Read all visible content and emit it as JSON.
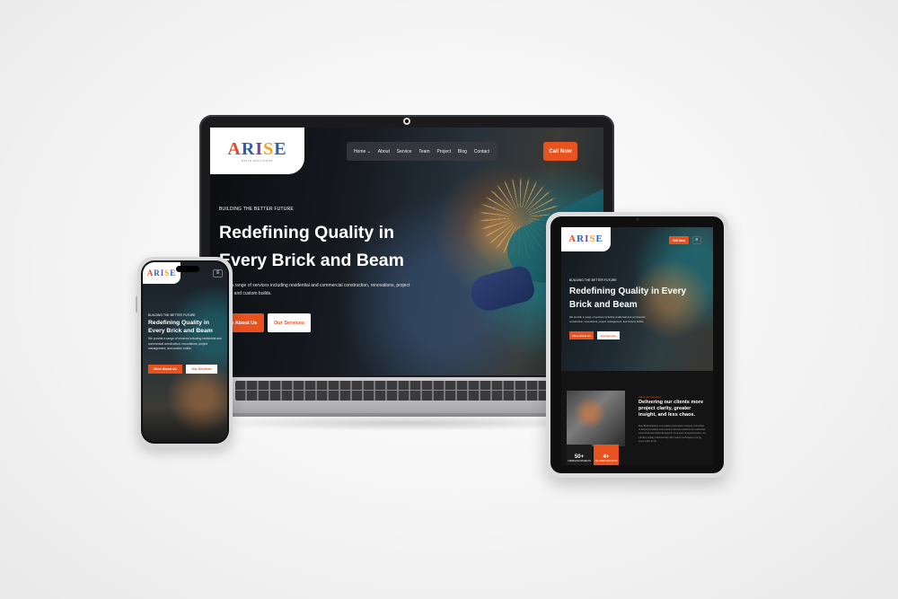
{
  "brand": {
    "logo_letters": [
      "A",
      "R",
      "I",
      "S",
      "E"
    ],
    "logo_tagline": "BUILD SOLUTIONS",
    "accent_color": "#e8521f"
  },
  "nav": {
    "items": [
      "Home",
      "About",
      "Service",
      "Team",
      "Project",
      "Blog",
      "Contact"
    ],
    "home_dropdown_icon": "chevron-down-icon",
    "cta": "Call Now",
    "menu_icon": "hamburger-menu-icon"
  },
  "hero": {
    "eyebrow": "BUILDING THE BETTER FUTURE",
    "title": "Redefining Quality in Every Brick and Beam",
    "laptop_desc": "ovide a range of services including residential and commercial construction, renovations, project ement, and custom builds.",
    "laptop_btn_primary": "ore About Us",
    "phone_desc": "We provide a range of services including residential and commercial construction, renovations, project management, and custom builds.",
    "tablet_desc": "We provide a range of services including residential and commercial construction, renovations, project management, and custom builds.",
    "btn_primary": "More About Us",
    "btn_secondary": "Our Services"
  },
  "about": {
    "tag": "About our Company",
    "title": "Delivering our clients more project clarity, greater insight, and less chaos.",
    "desc": "Rise Build Solutions is a leading construction company committed to delivering reliable and customer-focused solutions for residential, commercial and industrial projects. As a team of expert builders, we combine quality craftsmanship with modern techniques to bring every vision to life.",
    "stats": [
      {
        "value": "50+",
        "label": "COMPLETE PROJECTS"
      },
      {
        "value": "4+",
        "label": "ON-GOING PROJECTS"
      }
    ]
  }
}
